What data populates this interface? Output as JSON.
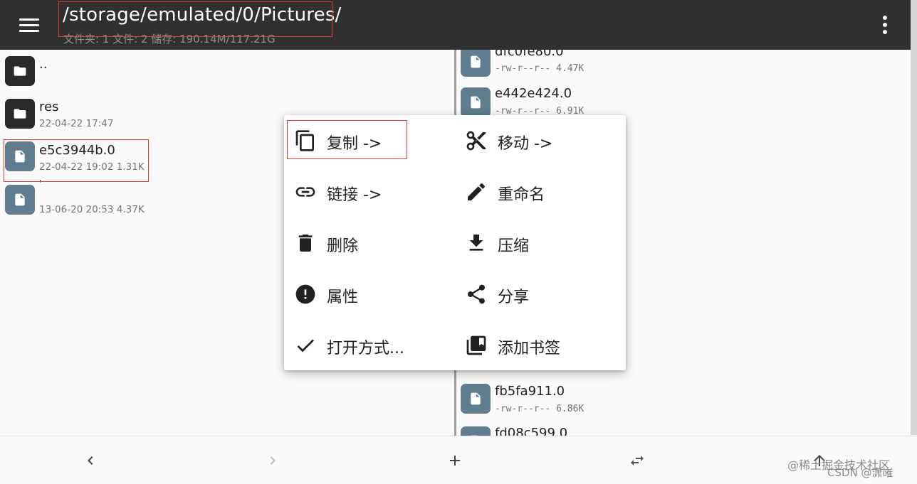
{
  "header": {
    "path": "/storage/emulated/0/Pictures/",
    "summary": "文件夹: 1  文件: 2  储存: 190.14M/117.21G",
    "menu_icon": "hamburger-menu-icon",
    "more_icon": "more-vert-icon"
  },
  "left_pane": {
    "items": [
      {
        "name": "..",
        "meta": "",
        "kind": "folder"
      },
      {
        "name": "res",
        "meta": "22-04-22 17:47",
        "kind": "folder"
      },
      {
        "name": "e5c3944b.0",
        "meta": "22-04-22 19:02  1.31K",
        "kind": "file"
      },
      {
        "name": "'",
        "meta": "13-06-20 20:53  4.37K",
        "kind": "file"
      }
    ]
  },
  "right_pane": {
    "items": [
      {
        "name": "dfc0fe80.0",
        "meta": "-rw-r--r--  4.47K"
      },
      {
        "name": "e442e424.0",
        "meta": "-rw-r--r--  6.91K"
      },
      {
        "name": "fb5fa911.0",
        "meta": "-rw-r--r--  6.86K"
      },
      {
        "name": "fd08c599.0",
        "meta": ""
      }
    ]
  },
  "context_menu": {
    "copy": "复制 ->",
    "move": "移动 ->",
    "link": "链接 ->",
    "rename": "重命名",
    "delete": "删除",
    "compress": "压缩",
    "properties": "属性",
    "share": "分享",
    "open_with": "打开方式...",
    "bookmark": "添加书签"
  },
  "bottom_bar": {
    "back_icon": "chevron-left-icon",
    "forward_icon": "chevron-right-icon",
    "add_icon": "plus-icon",
    "swap_icon": "swap-horizontal-icon",
    "up_icon": "arrow-up-icon"
  },
  "watermark": {
    "line1": "@稀土掘金技术社区",
    "line2": "CSDN @潇嶉"
  },
  "colors": {
    "appbar": "#303030",
    "file_icon": "#5f7d8e",
    "folder_icon": "#2b2b2b",
    "highlight": "#e53935"
  }
}
